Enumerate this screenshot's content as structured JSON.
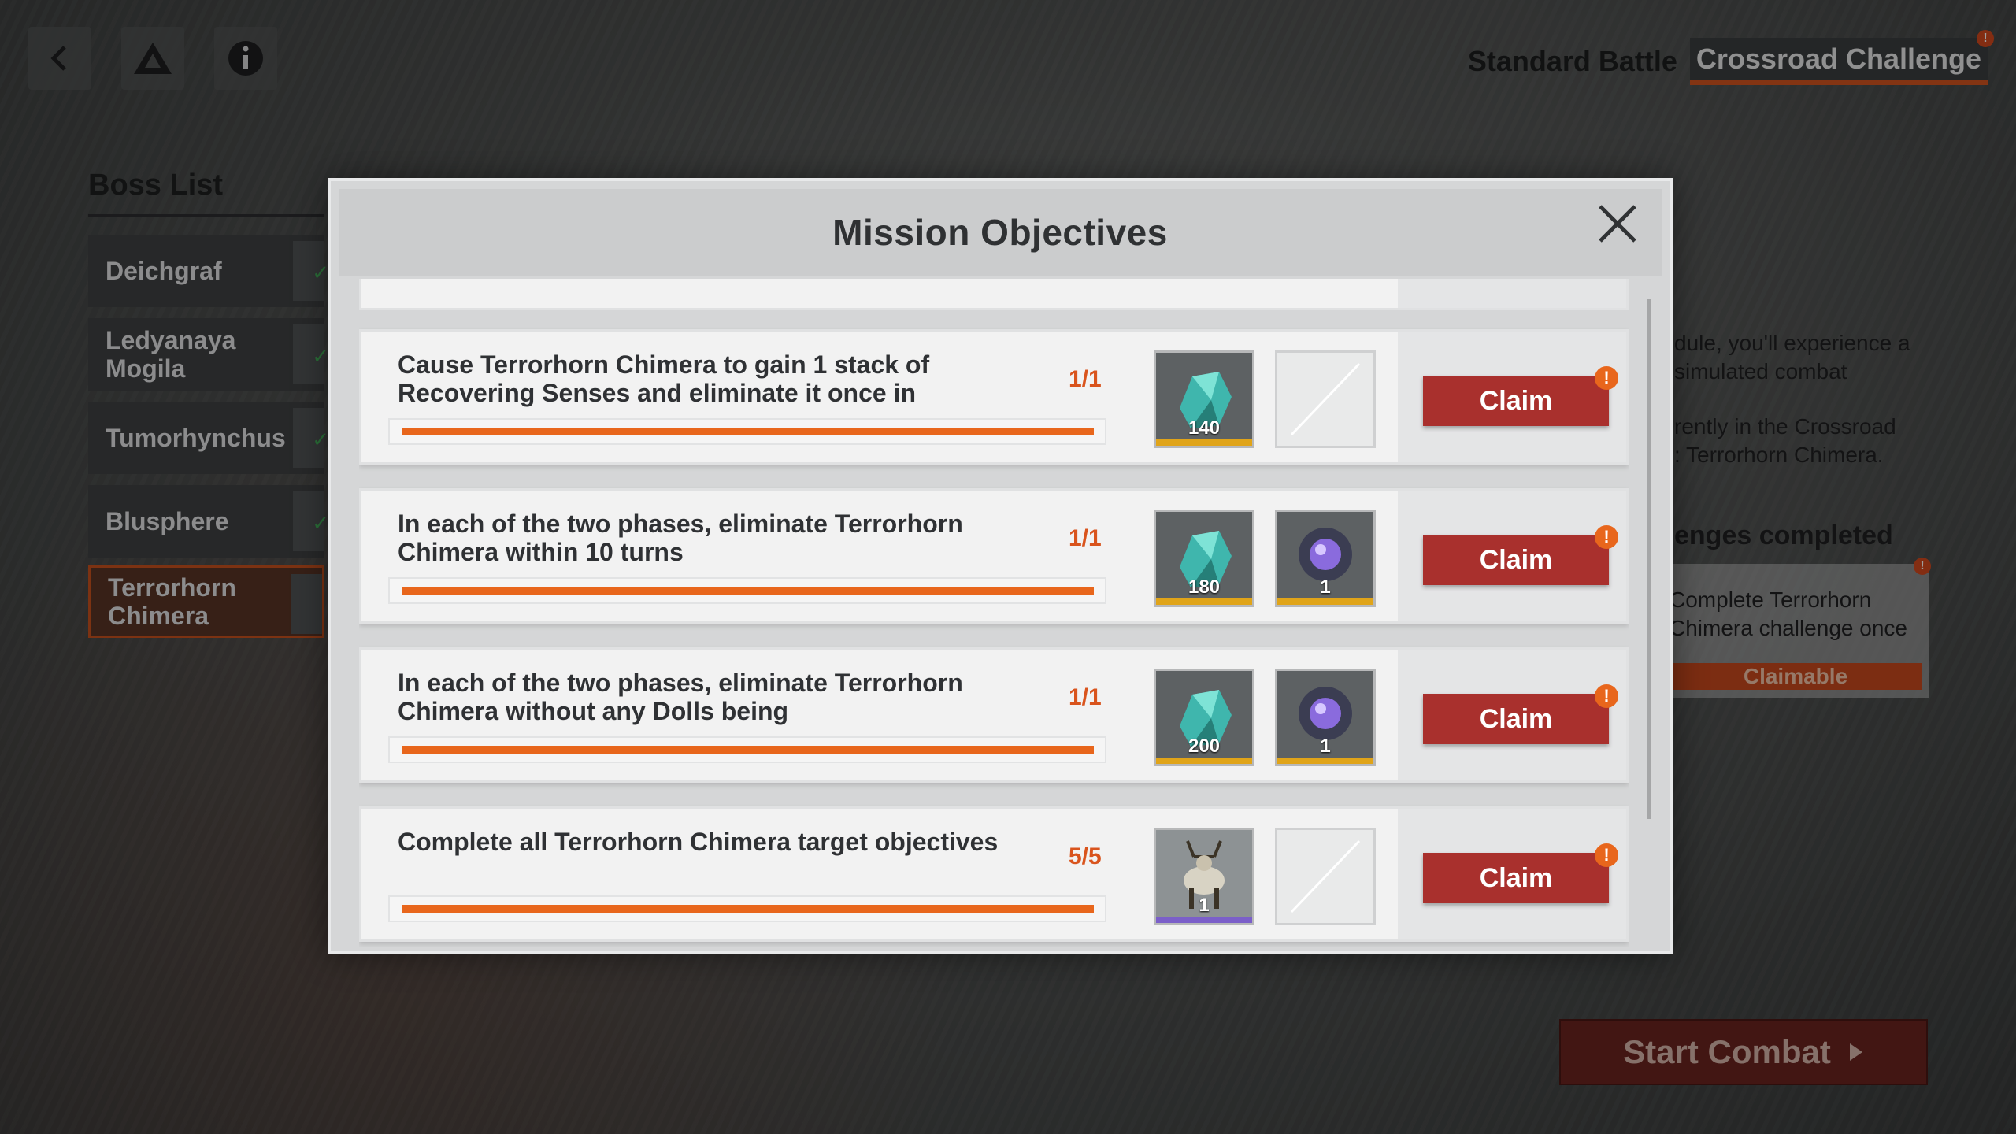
{
  "mode_tabs": {
    "standard": "Standard Battle",
    "crossroad": "Crossroad Challenge",
    "alert": "!"
  },
  "boss_list": {
    "title": "Boss List",
    "items": [
      {
        "name": "Deichgraf"
      },
      {
        "name": "Ledyanaya Mogila"
      },
      {
        "name": "Tumorhynchus"
      },
      {
        "name": "Blusphere"
      },
      {
        "name": "Terrorhorn Chimera"
      }
    ]
  },
  "behind": {
    "desc1": "dule, you'll experience a",
    "desc2": "simulated combat",
    "desc3": "rently in the Crossroad",
    "desc4": ": Terrorhorn Chimera.",
    "challenges_heading": "enges completed",
    "card_line1": "Complete Terrorhorn",
    "card_line2": "Chimera challenge once",
    "claimable": "Claimable",
    "alert": "!"
  },
  "start_combat": "Start Combat",
  "modal": {
    "title": "Mission Objectives",
    "missions": [
      {
        "text": "Cause Terrorhorn Chimera to gain 1 stack of Recovering Senses and eliminate it once in",
        "count": "1/1",
        "progress": 1.0,
        "rewards": [
          {
            "icon": "crystal-icon",
            "qty": "140"
          },
          {
            "icon": "empty-slot"
          }
        ],
        "claim": "Claim"
      },
      {
        "text": "In each of the two phases, eliminate Terrorhorn Chimera within 10 turns",
        "count": "1/1",
        "progress": 1.0,
        "rewards": [
          {
            "icon": "crystal-icon",
            "qty": "180"
          },
          {
            "icon": "orb-icon",
            "qty": "1"
          }
        ],
        "claim": "Claim"
      },
      {
        "text": "In each of the two phases, eliminate Terrorhorn Chimera without any Dolls being",
        "count": "1/1",
        "progress": 1.0,
        "rewards": [
          {
            "icon": "crystal-icon",
            "qty": "200"
          },
          {
            "icon": "orb-icon",
            "qty": "1"
          }
        ],
        "claim": "Claim"
      },
      {
        "text": "Complete all Terrorhorn Chimera target objectives",
        "count": "5/5",
        "progress": 1.0,
        "rewards": [
          {
            "icon": "deer-figure-icon",
            "qty": "1"
          },
          {
            "icon": "empty-slot"
          }
        ],
        "claim": "Claim"
      }
    ]
  }
}
